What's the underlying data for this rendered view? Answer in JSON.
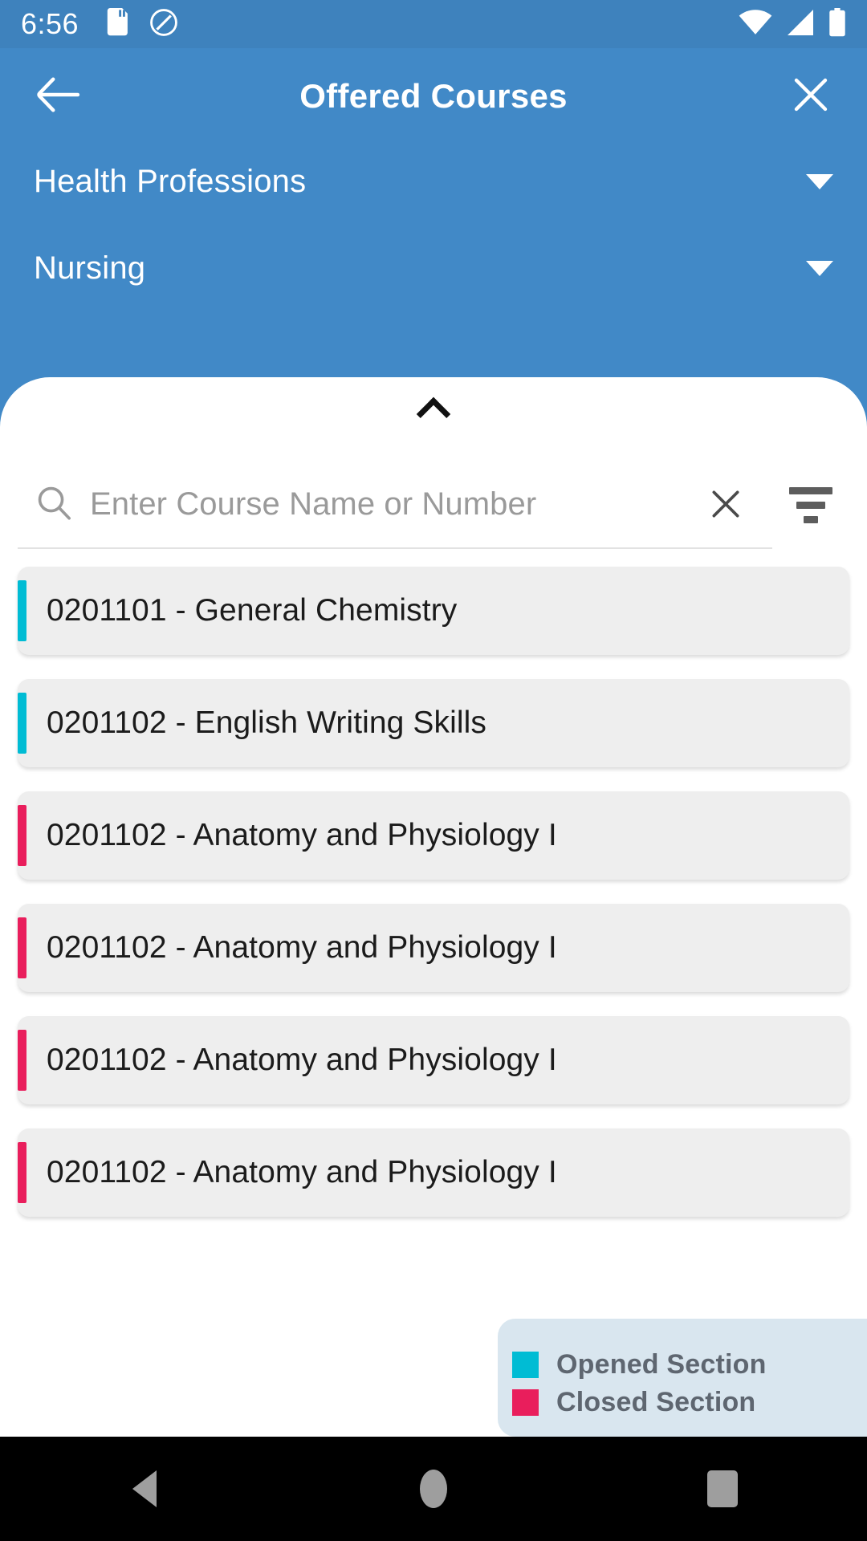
{
  "theme": {
    "primary_blue": "#4189c7",
    "statusbar_blue": "#3e82bd",
    "opened_color": "#00BCD4",
    "closed_color": "#E91E5C",
    "card_bg": "#EEEEEE"
  },
  "status_bar": {
    "time": "6:56",
    "icons_left": [
      "sd-card-icon",
      "do-not-disturb-icon"
    ],
    "icons_right": [
      "wifi-icon",
      "cellular-signal-icon",
      "battery-icon"
    ]
  },
  "app_bar": {
    "back_icon": "arrow-left-icon",
    "title": "Offered Courses",
    "close_icon": "close-icon"
  },
  "filters": {
    "college": {
      "label": "Health Professions",
      "caret_icon": "chevron-down-icon"
    },
    "department": {
      "label": "Nursing",
      "caret_icon": "chevron-down-icon"
    }
  },
  "sheet": {
    "handle_icon": "chevron-up-icon"
  },
  "search": {
    "search_icon": "search-icon",
    "placeholder": "Enter Course Name or Number",
    "value": "",
    "clear_icon": "close-icon",
    "filter_icon": "filter-icon"
  },
  "courses": [
    {
      "code": "0201101",
      "name": "General Chemistry",
      "title": "0201101 - General Chemistry",
      "status": "opened",
      "accent": "#00BCD4"
    },
    {
      "code": "0201102",
      "name": "English Writing Skills",
      "title": "0201102 - English Writing Skills",
      "status": "opened",
      "accent": "#00BCD4"
    },
    {
      "code": "0201102",
      "name": "Anatomy and Physiology I",
      "title": "0201102 - Anatomy and Physiology I",
      "status": "closed",
      "accent": "#E91E5C"
    },
    {
      "code": "0201102",
      "name": "Anatomy and Physiology I",
      "title": "0201102 - Anatomy and Physiology I",
      "status": "closed",
      "accent": "#E91E5C"
    },
    {
      "code": "0201102",
      "name": "Anatomy and Physiology I",
      "title": "0201102 - Anatomy and Physiology I",
      "status": "closed",
      "accent": "#E91E5C"
    },
    {
      "code": "0201102",
      "name": "Anatomy and Physiology I",
      "title": "0201102 - Anatomy and Physiology I",
      "status": "closed",
      "accent": "#E91E5C"
    }
  ],
  "legend": {
    "items": [
      {
        "label": "Opened Section",
        "color": "#00BCD4"
      },
      {
        "label": "Closed Section",
        "color": "#E91E5C"
      }
    ]
  },
  "nav_bar": {
    "back": "nav-back-icon",
    "home": "nav-home-icon",
    "recents": "nav-recents-icon"
  }
}
